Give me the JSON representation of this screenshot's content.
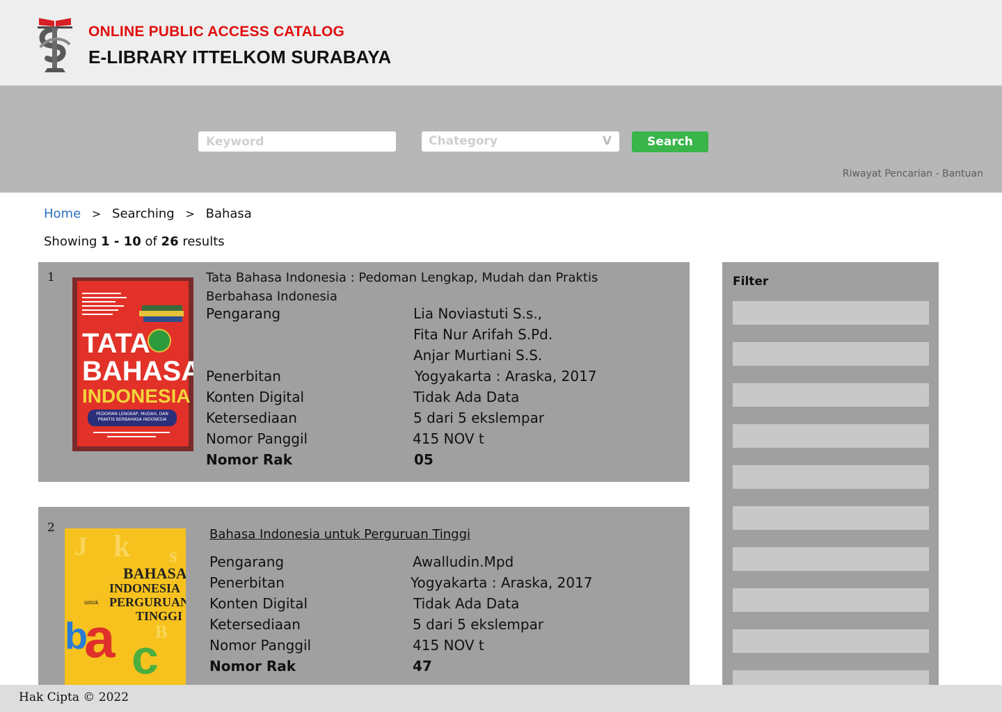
{
  "header": {
    "title_top": "ONLINE PUBLIC ACCESS CATALOG",
    "title_main": "E-LIBRARY ITTELKOM SURABAYA",
    "logo_icon": "ittelkom-logo-icon"
  },
  "search": {
    "keyword_placeholder": "Keyword",
    "category_placeholder": "Chategory",
    "category_arrow": "V",
    "button_label": "Search",
    "link_history": "Riwayat Pencarian",
    "link_separator": " - ",
    "link_help": "Bantuan"
  },
  "breadcrumb": {
    "home": "Home",
    "separator": ">",
    "searching": "Searching",
    "current": "Bahasa"
  },
  "results_summary": {
    "prefix": "Showing",
    "range": "1 - 10",
    "of": "of",
    "total": "26",
    "suffix": "results"
  },
  "results": [
    {
      "number": "1",
      "title": "Tata Bahasa Indonesia : Pedoman Lengkap, Mudah dan Praktis Berbahasa Indonesia",
      "cover": {
        "line1": "TATA",
        "line2": "BAHASA",
        "line3": "INDONESIA",
        "subtitle": "PEDOMAN LENGKAP, MUDAH, DAN PRAKTIS BERBAHASA INDONESIA"
      },
      "labels": {
        "author": "Pengarang",
        "publisher": "Penerbitan",
        "digital": "Konten Digital",
        "availability": "Ketersediaan",
        "call_number": "Nomor Panggil",
        "shelf": "Nomor Rak"
      },
      "authors": [
        "Lia Noviastuti S.s.,",
        "Fita Nur Arifah S.Pd.",
        "Anjar Murtiani S.S."
      ],
      "publisher": "Yogyakarta : Araska, 2017",
      "digital": "Tidak Ada Data",
      "availability": "5 dari 5 ekslempar",
      "call_number": "415 NOV t",
      "shelf": "05"
    },
    {
      "number": "2",
      "title": "Bahasa Indonesia untuk Perguruan Tinggi",
      "cover": {
        "line1": "BAHASA",
        "line2": "INDONESIA",
        "untuk": "untuk",
        "line3": "PERGURUAN",
        "line4": "TINGGI"
      },
      "labels": {
        "author": "Pengarang",
        "publisher": "Penerbitan",
        "digital": "Konten Digital",
        "availability": "Ketersediaan",
        "call_number": "Nomor Panggil",
        "shelf": "Nomor Rak"
      },
      "authors": [
        "Awalludin.Mpd"
      ],
      "publisher": "Yogyakarta : Araska, 2017",
      "digital": "Tidak Ada Data",
      "availability": "5 dari 5 ekslempar",
      "call_number": "415 NOV t",
      "shelf": "47"
    }
  ],
  "filter": {
    "title": "Filter"
  },
  "footer": {
    "copyright": "Hak Cipta © 2022"
  },
  "colors": {
    "brand_red": "#e10f0f",
    "search_green": "#39b54a",
    "link_blue": "#2a6ebd"
  }
}
